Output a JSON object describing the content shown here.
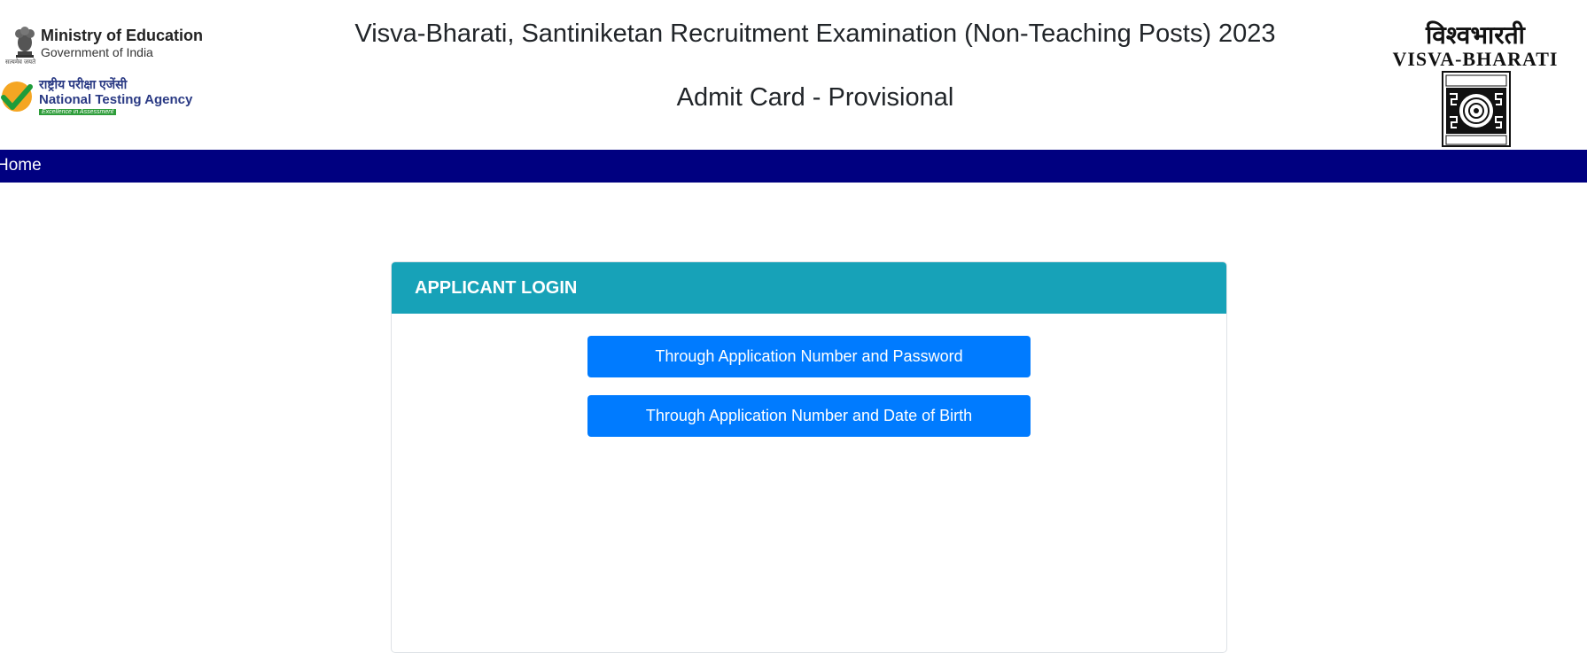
{
  "header": {
    "moe": {
      "title": "Ministry of Education",
      "subtitle": "Government of India",
      "tagline": "सत्यमेव जयते"
    },
    "nta": {
      "hindi": "राष्ट्रीय परीक्षा एजेंसी",
      "name": "National Testing Agency",
      "tagline": "Excellence in Assessment"
    },
    "title": "Visva-Bharati, Santiniketan Recruitment Examination (Non-Teaching Posts) 2023",
    "subtitle": "Admit Card - Provisional",
    "university": {
      "hindi": "विश्वभारती",
      "english": "VISVA-BHARATI"
    }
  },
  "navbar": {
    "home_label": "Home",
    "background": "#000080"
  },
  "login_card": {
    "title": "APPLICANT LOGIN",
    "header_color": "#17a2b8",
    "button_color": "#007bff",
    "buttons": [
      {
        "label": "Through Application Number and Password"
      },
      {
        "label": "Through Application Number and Date of Birth"
      }
    ]
  }
}
